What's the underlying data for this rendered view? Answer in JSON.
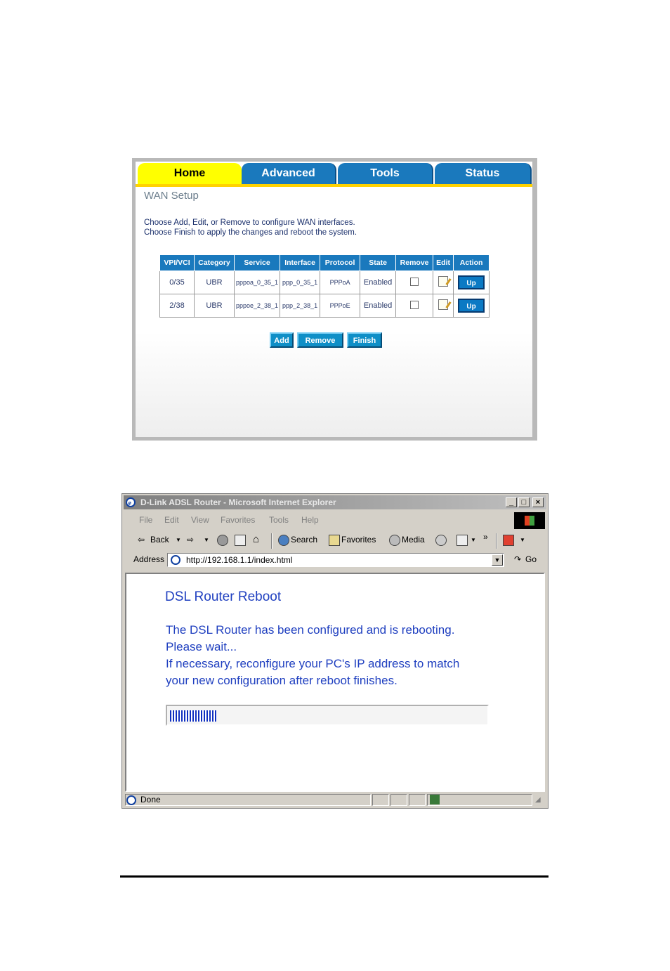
{
  "wan_screen": {
    "tabs": [
      "Home",
      "Advanced",
      "Tools",
      "Status"
    ],
    "title": "WAN Setup",
    "desc_line1": "Choose Add, Edit, or Remove to configure WAN interfaces.",
    "desc_line2": "Choose Finish to apply the changes and reboot the system.",
    "columns": [
      "VPI/VCI",
      "Category",
      "Service",
      "Interface",
      "Protocol",
      "State",
      "Remove",
      "Edit",
      "Action"
    ],
    "rows": [
      {
        "vpivci": "0/35",
        "category": "UBR",
        "service": "pppoa_0_35_1",
        "interface": "ppp_0_35_1",
        "protocol": "PPPoA",
        "state": "Enabled",
        "action": "Up"
      },
      {
        "vpivci": "2/38",
        "category": "UBR",
        "service": "pppoe_2_38_1",
        "interface": "ppp_2_38_1",
        "protocol": "PPPoE",
        "state": "Enabled",
        "action": "Up"
      }
    ],
    "buttons": {
      "add": "Add",
      "remove": "Remove",
      "finish": "Finish"
    }
  },
  "browser": {
    "title": "D-Link ADSL Router - Microsoft Internet Explorer",
    "menu": [
      "File",
      "Edit",
      "View",
      "Favorites",
      "Tools",
      "Help"
    ],
    "toolbar": {
      "back": "Back",
      "search": "Search",
      "favorites": "Favorites",
      "media": "Media",
      "chevron": "»"
    },
    "address_label": "Address",
    "address_url": "http://192.168.1.1/index.html",
    "go_label": "Go",
    "page": {
      "title": "DSL Router Reboot",
      "msg1": "The DSL Router has been configured and is rebooting.",
      "msg2": "Please wait...",
      "msg3": "If necessary, reconfigure your PC's IP address to match",
      "msg4": "your new configuration after reboot finishes.",
      "progress": 0.15
    },
    "status": "Done"
  }
}
